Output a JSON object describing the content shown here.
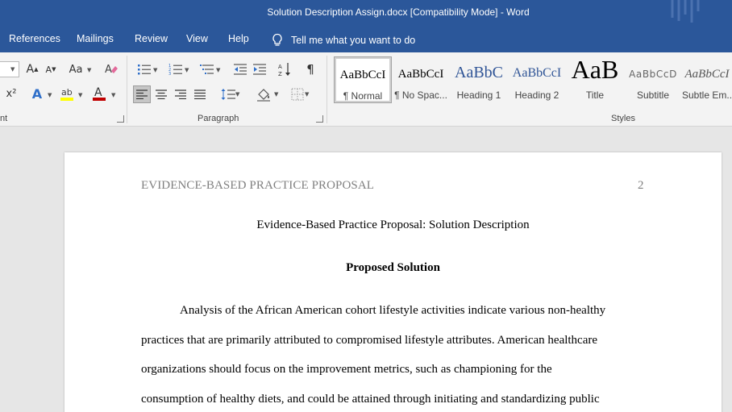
{
  "window": {
    "title": "Solution Description Assign.docx [Compatibility Mode]  -  Word"
  },
  "menu": {
    "items": [
      "References",
      "Mailings",
      "Review",
      "View",
      "Help"
    ],
    "tell_me": "Tell me what you want to do"
  },
  "ribbon": {
    "font_group_label": "nt",
    "paragraph_group_label": "Paragraph",
    "styles_group_label": "Styles",
    "font_color_accent": "#c00000",
    "highlight_accent": "#ffff00",
    "styles": [
      {
        "preview": "AaBbCcI",
        "name": "¶ Normal"
      },
      {
        "preview": "AaBbCcI",
        "name": "¶ No Spac..."
      },
      {
        "preview": "AaBbC",
        "name": "Heading 1"
      },
      {
        "preview": "AaBbCcI",
        "name": "Heading 2"
      },
      {
        "preview": "AaB",
        "name": "Title"
      },
      {
        "preview": "AaBbCcD",
        "name": "Subtitle"
      },
      {
        "preview": "AaBbCcI",
        "name": "Subtle Em..."
      }
    ]
  },
  "document": {
    "running_head": "EVIDENCE-BASED PRACTICE PROPOSAL",
    "page_number": "2",
    "title": "Evidence-Based Practice Proposal: Solution Description",
    "heading": "Proposed Solution",
    "paragraph_lines": [
      "Analysis of the African American cohort lifestyle activities indicate various non-healthy",
      "practices that are primarily attributed to compromised lifestyle attributes. American healthcare",
      "organizations should focus on the improvement metrics, such as championing for the",
      "consumption of healthy diets, and could be attained through initiating and standardizing public"
    ]
  }
}
